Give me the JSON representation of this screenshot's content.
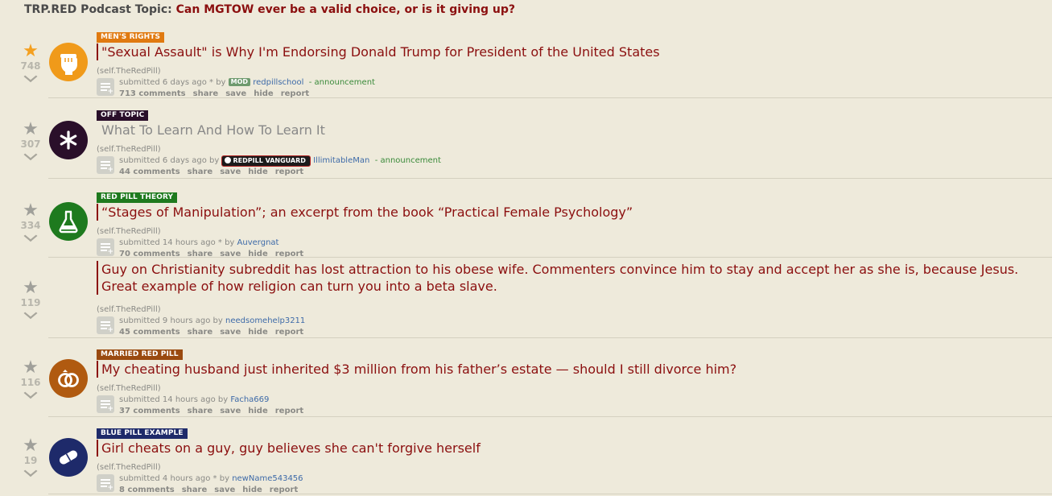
{
  "banner": {
    "label": "TRP.RED Podcast Topic:",
    "topic": "Can MGTOW ever be a valid choice, or is it giving up?"
  },
  "actions": {
    "share": "share",
    "save": "save",
    "hide": "hide",
    "report": "report"
  },
  "posts": [
    {
      "score": "748",
      "flair": "MEN'S RIGHTS",
      "flair_color": "#e07a10",
      "thumb_color": "#f09a1a",
      "thumb_icon": "raised-fist-icon",
      "title": "\"Sexual Assault\" is Why I'm Endorsing Donald Trump for President of the United States",
      "domain": "(self.TheRedPill)",
      "submitted": "submitted 6 days ago * by",
      "badge": "MOD",
      "author": "redpillschool",
      "distinguish": "- announcement",
      "comments": "713 comments"
    },
    {
      "score": "307",
      "flair": "OFF TOPIC",
      "flair_color": "#2a0f2a",
      "thumb_color": "#2a0f2a",
      "thumb_icon": "asterisk-icon",
      "title": "What To Learn And How To Learn It",
      "domain": "(self.TheRedPill)",
      "submitted": "submitted 6 days ago by",
      "badge": "REDPILL VANGUARD",
      "author": "IllimitableMan",
      "distinguish": "- announcement",
      "comments": "44 comments"
    },
    {
      "score": "334",
      "flair": "RED PILL THEORY",
      "flair_color": "#1e7a1e",
      "thumb_color": "#1e7a1e",
      "thumb_icon": "flask-icon",
      "title": "“Stages of Manipulation”; an excerpt from the book “Practical Female Psychology”",
      "domain": "(self.TheRedPill)",
      "submitted": "submitted 14 hours ago * by",
      "author": "Auvergnat",
      "comments": "70 comments"
    },
    {
      "score": "119",
      "title": "Guy on Christianity subreddit has lost attraction to his obese wife. Commenters convince him to stay and accept her as she is, because Jesus. Great example of how religion can turn you into a beta slave.",
      "domain": "(self.TheRedPill)",
      "submitted": "submitted 9 hours ago by",
      "author": "needsomehelp3211",
      "comments": "45 comments"
    },
    {
      "score": "116",
      "flair": "MARRIED RED PILL",
      "flair_color": "#9a4a10",
      "thumb_color": "#b05a10",
      "thumb_icon": "rings-icon",
      "title": "My cheating husband just inherited $3 million from his father’s estate — should I still divorce him?",
      "domain": "(self.TheRedPill)",
      "submitted": "submitted 14 hours ago by",
      "author": "Facha669",
      "comments": "37 comments"
    },
    {
      "score": "19",
      "flair": "BLUE PILL EXAMPLE",
      "flair_color": "#1e2a6a",
      "thumb_color": "#1e2a6a",
      "thumb_icon": "pill-icon",
      "title": "Girl cheats on a guy, guy believes she can't forgive herself",
      "domain": "(self.TheRedPill)",
      "submitted": "submitted 4 hours ago * by",
      "author": "newName543456",
      "comments": "8 comments"
    }
  ]
}
